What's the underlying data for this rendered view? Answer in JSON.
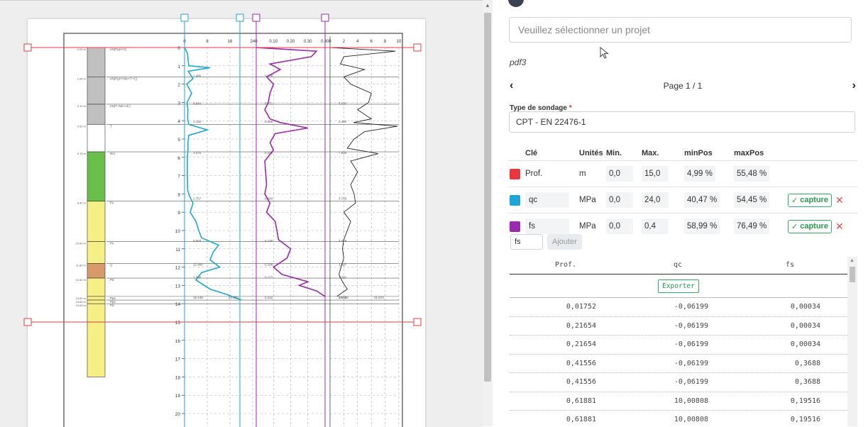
{
  "left_scroll": {
    "arrow_label": "▲"
  },
  "project": {
    "placeholder": "Veuillez sélectionner un projet"
  },
  "pdf_name": "pdf3",
  "pager": {
    "prev": "‹",
    "page_label": "Page 1 / 1",
    "next": "›"
  },
  "sounding": {
    "label": "Type de sondage",
    "required_mark": "*",
    "value": "CPT - EN 22476-1"
  },
  "keys_table": {
    "headers": {
      "key": "Clé",
      "unit": "Unités",
      "min": "Min.",
      "max": "Max.",
      "minpos": "minPos",
      "maxpos": "maxPos"
    },
    "rows": [
      {
        "color": "#e8383d",
        "key": "Prof.",
        "unit": "m",
        "min": "0,0",
        "max": "15,0",
        "minpos": "4,99 %",
        "maxpos": "55,48 %",
        "capture": ""
      },
      {
        "color": "#1ea7d6",
        "key": "qc",
        "unit": "MPa",
        "min": "0,0",
        "max": "24,0",
        "minpos": "40,47 %",
        "maxpos": "54,45 %",
        "capture": "capture"
      },
      {
        "color": "#9c27b0",
        "key": "fs",
        "unit": "MPa",
        "min": "0,0",
        "max": "0,4",
        "minpos": "58,99 %",
        "maxpos": "76,49 %",
        "capture": "capture"
      }
    ],
    "capture_check": "✓",
    "remove": "✕"
  },
  "add": {
    "value": "fs",
    "button": "Ajouter"
  },
  "data_table": {
    "headers": [
      "Prof.",
      "qc",
      "fs"
    ],
    "export": "Exporter",
    "rows": [
      [
        "0,01752",
        "-0,06199",
        "0,00034"
      ],
      [
        "0,21654",
        "-0,06199",
        "0,00034"
      ],
      [
        "0,21654",
        "-0,06199",
        "0,00034"
      ],
      [
        "0,41556",
        "-0,06199",
        "0,3688"
      ],
      [
        "0,41556",
        "-0,06199",
        "0,3688"
      ],
      [
        "0,61881",
        "10,00808",
        "0,19516"
      ],
      [
        "0,61881",
        "10,00808",
        "0,19516"
      ]
    ],
    "scroll_arrow": "▲"
  },
  "document": {
    "layers": [
      {
        "depth": "0.00 m",
        "desc": "nN(PgH+C)",
        "color": "#c0c0c0"
      },
      {
        "depth": "1.60 m",
        "desc": "nN(PgH+Nm+T+C)",
        "color": "#c0c0c0"
      },
      {
        "depth": "3.10 m",
        "desc": "nN(T+Nm+dr.)",
        "color": "#c0c0c0"
      },
      {
        "depth": "4.20 m",
        "desc": "T",
        "color": "#ffffff"
      },
      {
        "depth": "5.70 m",
        "desc": "Nm",
        "color": "#6abf4b"
      },
      {
        "depth": "8.40 m",
        "desc": "Ps",
        "color": "#f5ef86"
      },
      {
        "depth": "10.60 m",
        "desc": "Ps",
        "color": "#f5ef86"
      },
      {
        "depth": "11.80 m",
        "desc": "G",
        "color": "#d89a6a"
      },
      {
        "depth": "12.60 m",
        "desc": "Pd",
        "color": "#f5ef86"
      },
      {
        "depth": "13.60 m",
        "desc": "Pps",
        "color": "#f5ef86"
      },
      {
        "depth": "13.80 m",
        "desc": "Pps",
        "color": "#f5ef86"
      },
      {
        "depth": "14.00 m",
        "desc": "Pd",
        "color": "#f5ef86"
      }
    ],
    "qc_ticks": [
      "0",
      "8",
      "16",
      "24"
    ],
    "fs_ticks": [
      "0",
      "0.10",
      "0.20",
      "0.30",
      "0.40"
    ],
    "rf_ticks": [
      "0",
      "2",
      "4",
      "6",
      "8",
      "10"
    ],
    "depth_ticks": [
      "1",
      "2",
      "3",
      "4",
      "5",
      "6",
      "7",
      "8",
      "9",
      "10",
      "11",
      "12",
      "13",
      "14",
      "15",
      "16",
      "17",
      "18",
      "19",
      "20"
    ],
    "top_depth_label": "0",
    "qc_annotations": [
      {
        "depth": 1.5,
        "text": "1.486"
      },
      {
        "depth": 3.0,
        "text": "0.944"
      },
      {
        "depth": 4.0,
        "text": "1.150"
      },
      {
        "depth": 5.7,
        "text": "1.075"
      },
      {
        "depth": 8.2,
        "text": "1.757"
      },
      {
        "depth": 10.5,
        "text": "6.004"
      },
      {
        "depth": 11.8,
        "text": "12.460"
      },
      {
        "depth": 12.5,
        "text": "1.308"
      },
      {
        "depth": 13.6,
        "text": "15.148"
      },
      {
        "depth": 13.6,
        "text": "20.000"
      }
    ],
    "fs_annotations": [
      {
        "depth": 1.5,
        "text": "0.139"
      },
      {
        "depth": 3.0,
        "text": "0.071"
      },
      {
        "depth": 4.0,
        "text": "0.066"
      },
      {
        "depth": 5.7,
        "text": "0.105"
      },
      {
        "depth": 8.2,
        "text": "0.094"
      },
      {
        "depth": 10.5,
        "text": "0.130"
      },
      {
        "depth": 11.8,
        "text": "0.168"
      },
      {
        "depth": 12.5,
        "text": "0.177"
      },
      {
        "depth": 13.6,
        "text": "0.342"
      }
    ],
    "rf_annotations": [
      {
        "depth": 3.0,
        "text": "5.633"
      },
      {
        "depth": 4.0,
        "text": "3.360"
      },
      {
        "depth": 5.7,
        "text": "7.000"
      },
      {
        "depth": 8.2,
        "text": "3.743"
      },
      {
        "depth": 10.5,
        "text": "2.019"
      },
      {
        "depth": 11.8,
        "text": "1.597"
      },
      {
        "depth": 12.5,
        "text": "1.281"
      },
      {
        "depth": 13.6,
        "text": "2.478"
      },
      {
        "depth": 13.6,
        "text": "15.518"
      },
      {
        "depth": 13.6,
        "text": "21.670"
      }
    ],
    "qc_curve": [
      [
        0,
        0
      ],
      [
        0.3,
        1
      ],
      [
        1.0,
        1.5
      ],
      [
        1.1,
        9
      ],
      [
        1.3,
        1.3
      ],
      [
        1.7,
        3
      ],
      [
        2.0,
        0.8
      ],
      [
        2.5,
        2.5
      ],
      [
        3.0,
        0.9
      ],
      [
        3.4,
        1.2
      ],
      [
        3.9,
        1.1
      ],
      [
        4.2,
        1.5
      ],
      [
        4.5,
        8
      ],
      [
        4.8,
        1.5
      ],
      [
        5.2,
        1.2
      ],
      [
        5.6,
        1.2
      ],
      [
        6.0,
        1.0
      ],
      [
        7.0,
        1.0
      ],
      [
        7.8,
        1.1
      ],
      [
        8.1,
        1.7
      ],
      [
        8.5,
        3
      ],
      [
        9.0,
        2
      ],
      [
        9.5,
        4
      ],
      [
        10.0,
        5
      ],
      [
        10.4,
        6
      ],
      [
        10.8,
        12
      ],
      [
        11.2,
        10
      ],
      [
        11.6,
        9
      ],
      [
        12.0,
        12.4
      ],
      [
        12.3,
        6
      ],
      [
        12.7,
        4
      ],
      [
        13.2,
        9
      ],
      [
        13.5,
        15
      ],
      [
        13.8,
        20
      ]
    ],
    "fs_curve": [
      [
        0,
        0
      ],
      [
        0.2,
        0.35
      ],
      [
        0.5,
        0.32
      ],
      [
        0.9,
        0.08
      ],
      [
        1.2,
        0.14
      ],
      [
        1.6,
        0.06
      ],
      [
        2.0,
        0.1
      ],
      [
        2.5,
        0.08
      ],
      [
        3.0,
        0.07
      ],
      [
        3.4,
        0.05
      ],
      [
        3.9,
        0.08
      ],
      [
        4.1,
        0.14
      ],
      [
        4.4,
        0.3
      ],
      [
        4.7,
        0.11
      ],
      [
        5.2,
        0.08
      ],
      [
        5.6,
        0.1
      ],
      [
        6.2,
        0.05
      ],
      [
        7.5,
        0.06
      ],
      [
        8.0,
        0.05
      ],
      [
        8.5,
        0.08
      ],
      [
        9.0,
        0.06
      ],
      [
        9.5,
        0.11
      ],
      [
        10.0,
        0.12
      ],
      [
        10.5,
        0.13
      ],
      [
        11.0,
        0.2
      ],
      [
        11.5,
        0.18
      ],
      [
        12.0,
        0.1
      ],
      [
        12.4,
        0.15
      ],
      [
        12.8,
        0.3
      ],
      [
        13.0,
        0.25
      ],
      [
        13.3,
        0.35
      ],
      [
        13.6,
        0.4
      ]
    ],
    "rf_curve": [
      [
        0,
        0
      ],
      [
        0.2,
        9.5
      ],
      [
        0.5,
        2
      ],
      [
        0.9,
        1.5
      ],
      [
        1.2,
        5
      ],
      [
        1.6,
        2
      ],
      [
        2.0,
        3
      ],
      [
        2.5,
        6
      ],
      [
        3.0,
        5.6
      ],
      [
        3.4,
        4
      ],
      [
        3.9,
        6
      ],
      [
        4.1,
        3.4
      ],
      [
        4.3,
        9.8
      ],
      [
        4.6,
        5
      ],
      [
        5.0,
        3.5
      ],
      [
        5.5,
        2.5
      ],
      [
        5.8,
        7
      ],
      [
        6.2,
        3
      ],
      [
        6.8,
        4
      ],
      [
        7.5,
        3
      ],
      [
        8.0,
        3.5
      ],
      [
        8.5,
        3.7
      ],
      [
        9.0,
        2
      ],
      [
        9.5,
        3
      ],
      [
        10.0,
        2.5
      ],
      [
        10.5,
        2
      ],
      [
        11.0,
        1.8
      ],
      [
        11.5,
        2
      ],
      [
        12.0,
        1.6
      ],
      [
        12.4,
        1.3
      ],
      [
        12.8,
        1.8
      ],
      [
        13.2,
        2.5
      ],
      [
        13.6,
        1
      ]
    ]
  }
}
